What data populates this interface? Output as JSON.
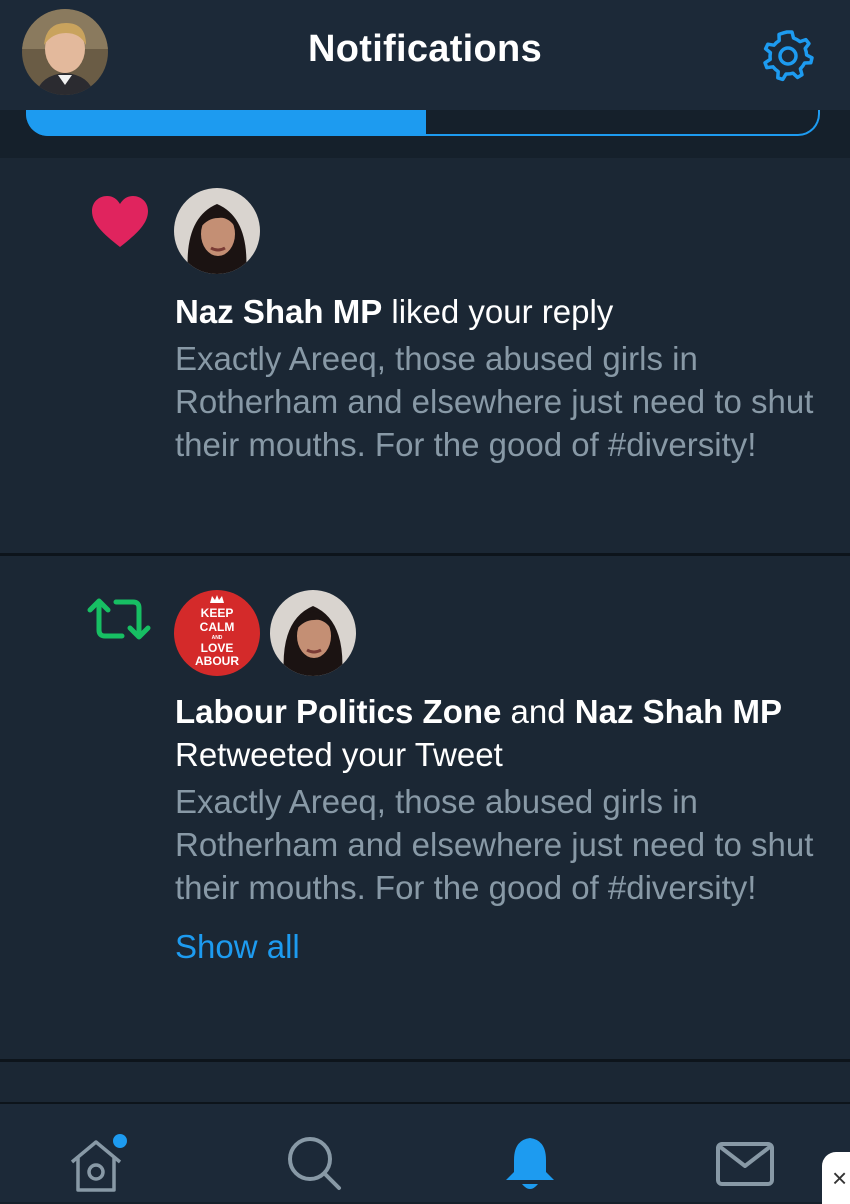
{
  "header": {
    "title": "Notifications"
  },
  "notifications": [
    {
      "type": "like",
      "actor": "Naz Shah MP",
      "action": " liked your reply",
      "text": "Exactly Areeq, those abused girls in Rotherham and elsewhere just need to shut their mouths. For the good of #diversity!"
    },
    {
      "type": "retweet",
      "actor1": "Labour Politics Zone",
      "joiner": " and ",
      "actor2": "Naz Shah MP",
      "action": " Retweeted your Tweet",
      "text": "Exactly Areeq, those abused girls in Rotherham and elsewhere just need to shut their mouths. For the good of #diversity!",
      "show_all": "Show all"
    }
  ],
  "keep_calm_logo": {
    "line1": "KEEP",
    "line2": "CALM",
    "line3": "AND",
    "line4": "LOVE",
    "line5": "ABOUR"
  },
  "icons": {
    "like": "heart-icon",
    "retweet": "retweet-icon",
    "settings": "gear-icon",
    "home": "home-icon",
    "search": "search-icon",
    "notifications": "bell-icon",
    "messages": "mail-icon",
    "close": "close-icon"
  },
  "close_label": "×",
  "colors": {
    "background": "#15202b",
    "accent": "#1d9bf0",
    "like": "#e0245e",
    "retweet": "#17bf63",
    "secondary_text": "#8899a6"
  }
}
